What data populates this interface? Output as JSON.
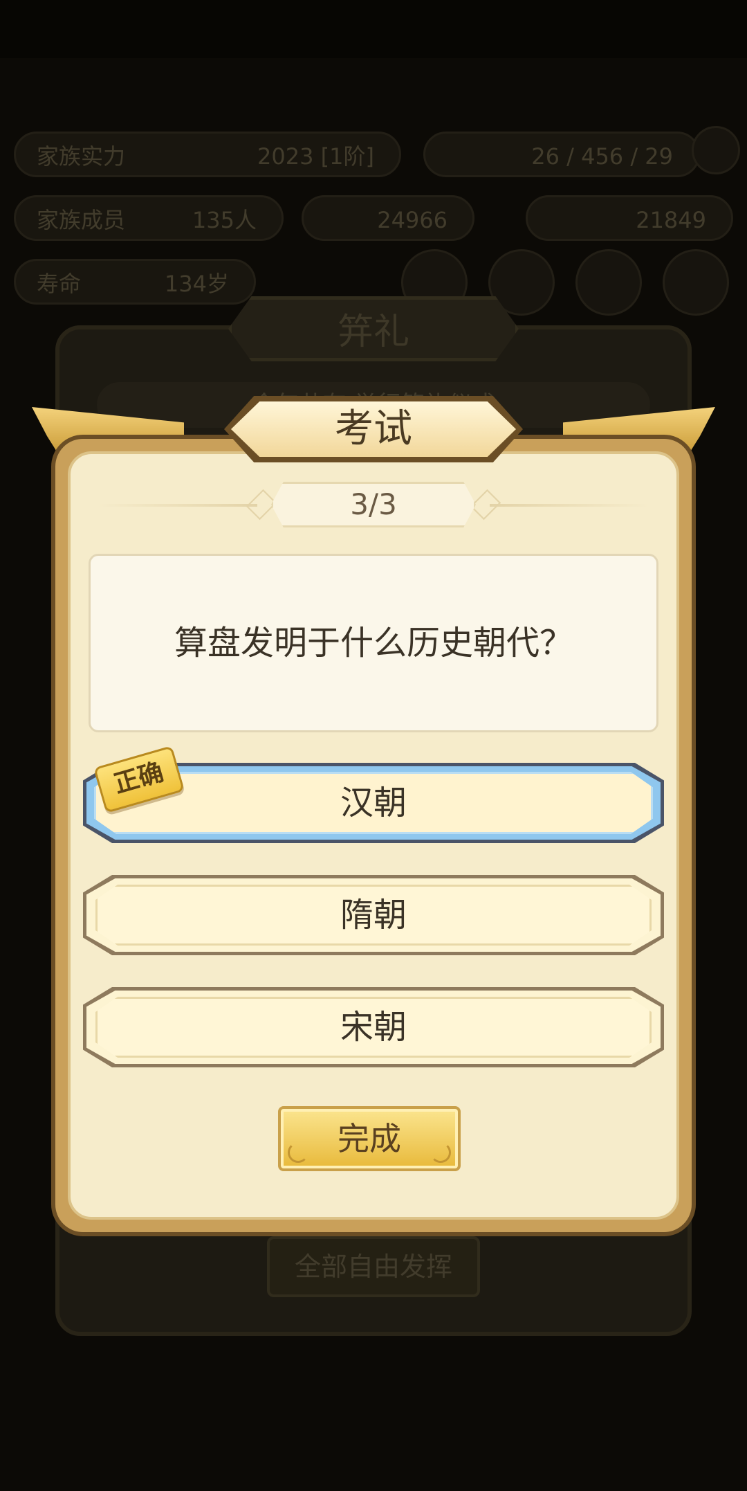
{
  "background": {
    "hud_rows": [
      {
        "key": "家族实力",
        "value": "2023 [1阶]"
      },
      {
        "key": "",
        "value": "26 / 456 / 29"
      },
      {
        "key": "家族成员",
        "value": "135人"
      },
      {
        "key": "",
        "value": "24966"
      },
      {
        "key": "",
        "value": "21849"
      },
      {
        "key": "寿命",
        "value": "134岁"
      }
    ],
    "panel_title": "笄礼",
    "panel_subtitle": "今年共有    举行笄礼仪式",
    "bottom_button": "全部自由发挥"
  },
  "dialog": {
    "title": "考试",
    "progress": "3/3",
    "question": "算盘发明于什么历史朝代？",
    "options": [
      {
        "label": "汉朝",
        "state": "correct"
      },
      {
        "label": "隋朝",
        "state": "normal"
      },
      {
        "label": "宋朝",
        "state": "normal"
      }
    ],
    "correct_badge": "正确",
    "done_button": "完成"
  },
  "colors": {
    "dialog_bg": "#f6eccb",
    "frame_gold": "#c9a05a",
    "correct_outline": "#8fc7ee",
    "button_gold": "#e8b93a"
  }
}
